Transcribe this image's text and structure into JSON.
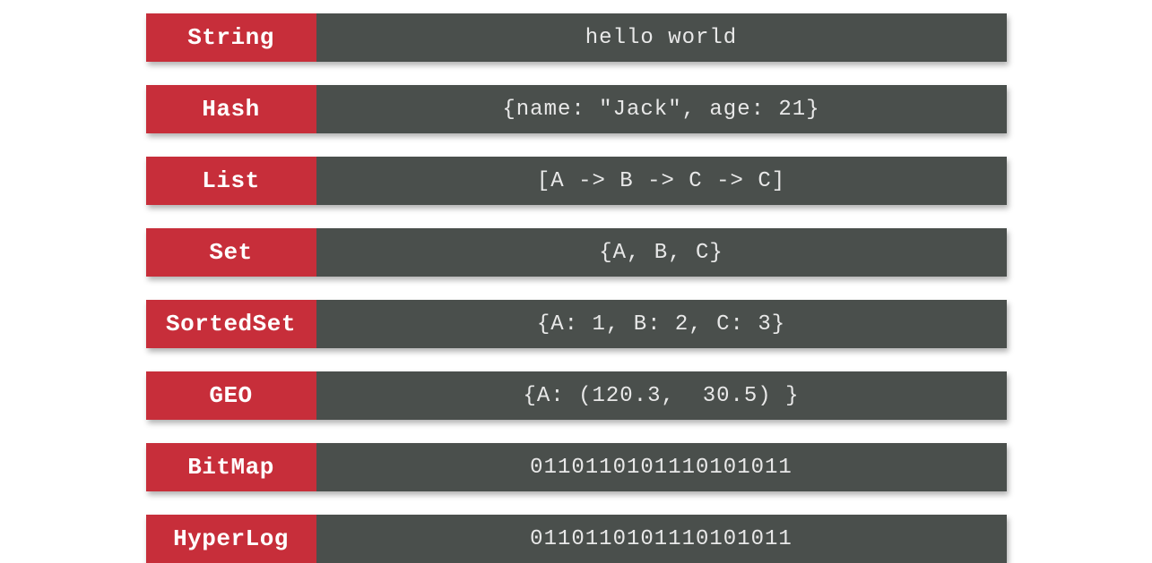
{
  "colors": {
    "label_bg": "#c72e3a",
    "value_bg": "#4a4f4c",
    "label_text": "#ffffff",
    "value_text": "#e8e8e8"
  },
  "rows": [
    {
      "label": "String",
      "value": "hello world"
    },
    {
      "label": "Hash",
      "value": "{name: \"Jack\", age: 21}"
    },
    {
      "label": "List",
      "value": "[A -> B -> C -> C]"
    },
    {
      "label": "Set",
      "value": "{A, B, C}"
    },
    {
      "label": "SortedSet",
      "value": "{A: 1, B: 2, C: 3}"
    },
    {
      "label": "GEO",
      "value": "{A: (120.3,  30.5) }"
    },
    {
      "label": "BitMap",
      "value": "0110110101110101011"
    },
    {
      "label": "HyperLog",
      "value": "0110110101110101011"
    }
  ]
}
